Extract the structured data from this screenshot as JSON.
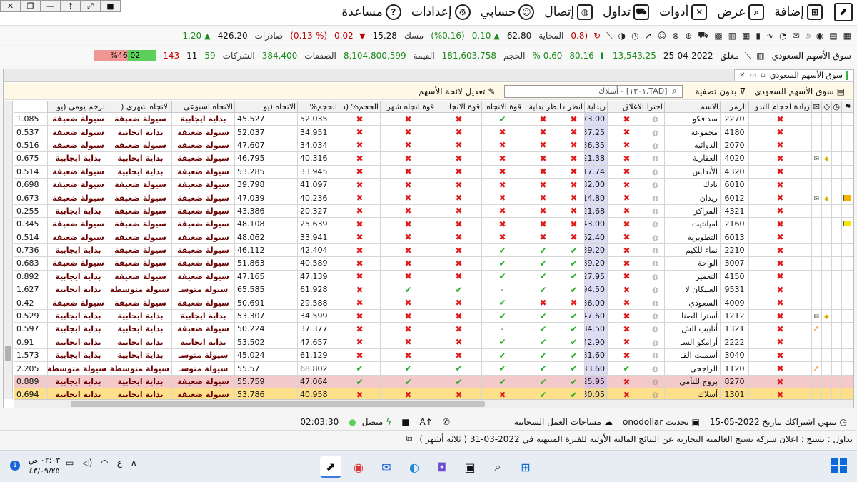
{
  "menu": {
    "items": [
      {
        "label": "إضافة",
        "icon": "add-page-icon"
      },
      {
        "label": "عرض",
        "icon": "view-icon"
      },
      {
        "label": "أدوات",
        "icon": "tools-icon"
      },
      {
        "label": "تداول",
        "icon": "trading-cart-icon"
      },
      {
        "label": "إتصال",
        "icon": "connect-globe-icon"
      },
      {
        "label": "حسابي",
        "icon": "user-icon"
      },
      {
        "label": "إعدادات",
        "icon": "gear-icon"
      },
      {
        "label": "مساعدة",
        "icon": "help-icon"
      }
    ]
  },
  "stats1": {
    "exports_label": "صادرات",
    "exports_value": "426.20",
    "exports_change": "1.20",
    "musk_label": "مسك",
    "musk_value": "15.28",
    "musk_change": "-0.02",
    "musk_pct": "(%-0.13)",
    "makhaya_label": "المخاية",
    "makhaya_value": "62.80",
    "makhaya_change": "0.10",
    "makhaya_pct": "(%0.16)",
    "extra_value": "(0.8"
  },
  "stats2": {
    "market_label": "سوق الأسهم السعودي",
    "status": "مغلق",
    "date": "25-04-2022",
    "index_value": "13,543.25",
    "change": "80.16",
    "change_pct": "0.60 %",
    "volume_label": "الحجم",
    "volume_value": "181,603,758",
    "value_label": "القيمة",
    "value_value": "8,104,800,599",
    "deals_label": "الصفقات",
    "deals_value": "384,400",
    "companies_label": "الشركات",
    "companies_up": "59",
    "companies_flat": "11",
    "companies_down": "143",
    "breadth_pct": "%46.02",
    "breadth_fraction": 0.4602
  },
  "panel": {
    "tab_label": "سوق الأسهم السعودي",
    "market_filter": "سوق الأسهم السعودي",
    "no_filter": "بدون تصفية",
    "search_value": "[TAD.١٣٠١] - أسلاك",
    "edit_list": "تعديل لائحة الأسهم"
  },
  "columns": [
    "زيادة احجام التدو",
    "الرمز",
    "الاسم",
    "اختراق",
    "الاغلاق",
    "ريداية ا",
    "انظر ب",
    "انظر بداية",
    "قوة الاتجاه",
    "قوة الاتجا",
    "قوة اتجاه شهر",
    "الحجم% (د",
    "الحجم%",
    "الاتجاه (يو",
    "الاتجاه اسبوعي",
    "الاتجاه شهري (",
    "الزخم يومي (يو"
  ],
  "rows": [
    {
      "code": "2270",
      "name": "سدافكو",
      "close": "173.00",
      "c1": "x",
      "c2": "x",
      "c3": "ok",
      "c4": "x",
      "c5": "x",
      "c6": "x",
      "vol1": "52.035",
      "vol2": "45.527",
      "d": "بداية ايجابية",
      "w": "سيولة ضعيفة",
      "m": "سيولة ضعيفة",
      "mom": "1.085",
      "style": "",
      "flag": "",
      "alert": false,
      "trend": false
    },
    {
      "code": "4180",
      "name": "مجموعة",
      "close": "37.25",
      "c1": "x",
      "c2": "x",
      "c3": "x",
      "c4": "x",
      "c5": "x",
      "c6": "x",
      "vol1": "34.951",
      "vol2": "52.037",
      "d": "سيولة ضعيفة",
      "w": "بداية ايجابية",
      "m": "سيولة ضعيفة",
      "mom": "0.537",
      "style": "",
      "flag": "",
      "alert": false,
      "trend": false
    },
    {
      "code": "2070",
      "name": "الدوائية",
      "close": "36.35",
      "c1": "x",
      "c2": "x",
      "c3": "x",
      "c4": "x",
      "c5": "x",
      "c6": "x",
      "vol1": "34.034",
      "vol2": "47.607",
      "d": "سيولة ضعيفة",
      "w": "سيولة ضعيفة",
      "m": "سيولة ضعيفة",
      "mom": "0.516",
      "style": "",
      "flag": "",
      "alert": false,
      "trend": false
    },
    {
      "code": "4020",
      "name": "العقارية",
      "close": "21.38",
      "c1": "x",
      "c2": "x",
      "c3": "x",
      "c4": "x",
      "c5": "x",
      "c6": "x",
      "vol1": "40.316",
      "vol2": "46.795",
      "d": "سيولة ضعيفة",
      "w": "بداية ايجابية",
      "m": "بداية ايجابية",
      "mom": "0.675",
      "style": "",
      "flag": "",
      "alert": true,
      "trend": false
    },
    {
      "code": "4320",
      "name": "الأندلس",
      "close": "17.74",
      "c1": "x",
      "c2": "x",
      "c3": "x",
      "c4": "x",
      "c5": "x",
      "c6": "x",
      "vol1": "33.945",
      "vol2": "53.285",
      "d": "سيولة ضعيفة",
      "w": "بداية ايجابية",
      "m": "سيولة ضعيفة",
      "mom": "0.514",
      "style": "",
      "flag": "",
      "alert": false,
      "trend": false
    },
    {
      "code": "6010",
      "name": "نادك",
      "close": "32.00",
      "c1": "x",
      "c2": "x",
      "c3": "x",
      "c4": "x",
      "c5": "x",
      "c6": "x",
      "vol1": "41.097",
      "vol2": "39.798",
      "d": "سيولة ضعيفة",
      "w": "سيولة ضعيفة",
      "m": "سيولة ضعيفة",
      "mom": "0.698",
      "style": "",
      "flag": "",
      "alert": false,
      "trend": false
    },
    {
      "code": "6012",
      "name": "ريدان",
      "close": "14.80",
      "c1": "x",
      "c2": "x",
      "c3": "x",
      "c4": "x",
      "c5": "x",
      "c6": "x",
      "vol1": "40.236",
      "vol2": "47.039",
      "d": "سيولة ضعيفة",
      "w": "سيولة ضعيفة",
      "m": "سيولة ضعيفة",
      "mom": "0.673",
      "style": "",
      "flag": "orange",
      "alert": true,
      "trend": false
    },
    {
      "code": "4321",
      "name": "المراكز",
      "close": "21.68",
      "c1": "x",
      "c2": "x",
      "c3": "x",
      "c4": "x",
      "c5": "x",
      "c6": "x",
      "vol1": "20.327",
      "vol2": "43.386",
      "d": "سيولة ضعيفة",
      "w": "سيولة ضعيفة",
      "m": "بداية ايجابية",
      "mom": "0.255",
      "style": "",
      "flag": "",
      "alert": false,
      "trend": false
    },
    {
      "code": "2160",
      "name": "اميانتيت",
      "close": "43.00",
      "c1": "x",
      "c2": "x",
      "c3": "x",
      "c4": "x",
      "c5": "x",
      "c6": "x",
      "vol1": "25.639",
      "vol2": "48.108",
      "d": "سيولة ضعيفة",
      "w": "سيولة ضعيفة",
      "m": "سيولة ضعيفة",
      "mom": "0.345",
      "style": "",
      "flag": "yellow",
      "alert": false,
      "trend": false
    },
    {
      "code": "6013",
      "name": "التطويرية",
      "close": "262.40",
      "c1": "x",
      "c2": "x",
      "c3": "x",
      "c4": "x",
      "c5": "x",
      "c6": "x",
      "vol1": "33.941",
      "vol2": "48.062",
      "d": "سيولة ضعيفة",
      "w": "سيولة ضعيفة",
      "m": "سيولة ضعيفة",
      "mom": "0.514",
      "style": "",
      "flag": "",
      "alert": false,
      "trend": false
    },
    {
      "code": "2210",
      "name": "نماء للكيم",
      "close": "39.20",
      "c1": "x",
      "c2": "ok",
      "c3": "ok",
      "c4": "x",
      "c5": "x",
      "c6": "x",
      "vol1": "42.404",
      "vol2": "46.112",
      "d": "سيولة ضعيفة",
      "w": "سيولة ضعيفة",
      "m": "بداية ايجابية",
      "mom": "0.736",
      "style": "",
      "flag": "",
      "alert": false,
      "trend": false
    },
    {
      "code": "3007",
      "name": "الواحة",
      "close": "89.20",
      "c1": "x",
      "c2": "ok",
      "c3": "ok",
      "c4": "x",
      "c5": "x",
      "c6": "x",
      "vol1": "40.589",
      "vol2": "51.863",
      "d": "سيولة ضعيفة",
      "w": "سيولة ضعيفة",
      "m": "سيولة ضعيفة",
      "mom": "0.683",
      "style": "",
      "flag": "",
      "alert": false,
      "trend": false
    },
    {
      "code": "4150",
      "name": "التعمير",
      "close": "27.95",
      "c1": "x",
      "c2": "ok",
      "c3": "ok",
      "c4": "x",
      "c5": "x",
      "c6": "x",
      "vol1": "47.139",
      "vol2": "47.165",
      "d": "سيولة ضعيفة",
      "w": "سيولة ضعيفة",
      "m": "بداية ايجابية",
      "mom": "0.892",
      "style": "",
      "flag": "",
      "alert": false,
      "trend": false
    },
    {
      "code": "9531",
      "name": "العبيكان لا",
      "close": "94.50",
      "c1": "x",
      "c2": "ok",
      "c3": "dash",
      "c4": "ok",
      "c5": "ok",
      "c6": "x",
      "vol1": "61.928",
      "vol2": "65.585",
      "d": "سيولة متوسـ",
      "w": "سيولة متوسطة",
      "m": "بداية ايجابية",
      "mom": "1.627",
      "style": "",
      "flag": "",
      "alert": false,
      "trend": false
    },
    {
      "code": "4009",
      "name": "السعودي",
      "close": "36.00",
      "c1": "x",
      "c2": "x",
      "c3": "ok",
      "c4": "x",
      "c5": "x",
      "c6": "x",
      "vol1": "29.588",
      "vol2": "50.691",
      "d": "سيولة ضعيفة",
      "w": "سيولة ضعيفة",
      "m": "سيولة ضعيفة",
      "mom": "0.42",
      "style": "",
      "flag": "",
      "alert": false,
      "trend": false
    },
    {
      "code": "1212",
      "name": "أسترا الصنا",
      "close": "47.60",
      "c1": "x",
      "c2": "ok",
      "c3": "ok",
      "c4": "x",
      "c5": "x",
      "c6": "x",
      "vol1": "34.599",
      "vol2": "53.307",
      "d": "بداية ايجابية",
      "w": "بداية ايجابية",
      "m": "بداية ايجابية",
      "mom": "0.529",
      "style": "",
      "flag": "",
      "alert": true,
      "trend": false
    },
    {
      "code": "1321",
      "name": "أنابيب الش",
      "close": "84.50",
      "c1": "x",
      "c2": "ok",
      "c3": "dash",
      "c4": "x",
      "c5": "x",
      "c6": "x",
      "vol1": "37.377",
      "vol2": "50.224",
      "d": "سيولة ضعيفة",
      "w": "بداية ايجابية",
      "m": "بداية ايجابية",
      "mom": "0.597",
      "style": "",
      "flag": "",
      "alert": false,
      "trend": true
    },
    {
      "code": "2222",
      "name": "أرامكو السـ",
      "close": "42.90",
      "c1": "x",
      "c2": "ok",
      "c3": "ok",
      "c4": "x",
      "c5": "x",
      "c6": "x",
      "vol1": "47.657",
      "vol2": "53.502",
      "d": "بداية ايجابية",
      "w": "بداية ايجابية",
      "m": "بداية ايجابية",
      "mom": "0.91",
      "style": "",
      "flag": "",
      "alert": false,
      "trend": false
    },
    {
      "code": "3040",
      "name": "أسمنت القـ",
      "close": "81.60",
      "c1": "x",
      "c2": "ok",
      "c3": "ok",
      "c4": "x",
      "c5": "x",
      "c6": "x",
      "vol1": "61.129",
      "vol2": "45.024",
      "d": "سيولة متوسـ",
      "w": "بداية ايجابية",
      "m": "بداية ايجابية",
      "mom": "1.573",
      "style": "",
      "flag": "",
      "alert": false,
      "trend": false
    },
    {
      "code": "1120",
      "name": "الراجحي",
      "close": "183.60",
      "c1": "ok",
      "c2": "ok",
      "c3": "ok",
      "c4": "ok",
      "c5": "ok",
      "c6": "ok",
      "vol1": "68.802",
      "vol2": "55.57",
      "d": "سيولة متوسـ",
      "w": "سيولة متوسطة",
      "m": "سيولة متوسطة",
      "mom": "2.205",
      "style": "",
      "flag": "",
      "alert": false,
      "trend": true
    },
    {
      "code": "8270",
      "name": "بروج للتأمي",
      "close": "25.95",
      "c1": "x",
      "c2": "ok",
      "c3": "ok",
      "c4": "ok",
      "c5": "ok",
      "c6": "ok",
      "vol1": "47.064",
      "vol2": "55.759",
      "d": "سيولة ضعيفة",
      "w": "بداية ايجابية",
      "m": "بداية ايجابية",
      "mom": "0.889",
      "style": "pink",
      "flag": "",
      "alert": false,
      "trend": false
    },
    {
      "code": "1301",
      "name": "أسلاك",
      "close": "30.05",
      "c1": "x",
      "c2": "ok",
      "c3": "x",
      "c4": "x",
      "c5": "x",
      "c6": "x",
      "vol1": "40.958",
      "vol2": "53.786",
      "d": "سيولة ضعيفة",
      "w": "بداية ايجابية",
      "m": "بداية ايجابية",
      "mom": "0.694",
      "style": "yellow",
      "flag": "",
      "alert": false,
      "trend": false
    }
  ],
  "status": {
    "subscription": "ينتهي اشتراكك بتاريخ 2022-05-15",
    "update": "تحديث onodollar",
    "cloud": "مساحات العمل السحابية",
    "connected": "متصل",
    "time": "02:03:30"
  },
  "news": {
    "text": "تداول : نسيج : اعلان شركة نسيج العالمية التجارية عن النتائج المالية الأولية للفترة المنتهية في 2022-03-31 ( ثلاثة أشهر )"
  },
  "taskbar": {
    "time": "٠٢:٠٣ ص",
    "date": "٤٣/٠٩/٢٥",
    "lang": "ع",
    "notif": "1"
  }
}
